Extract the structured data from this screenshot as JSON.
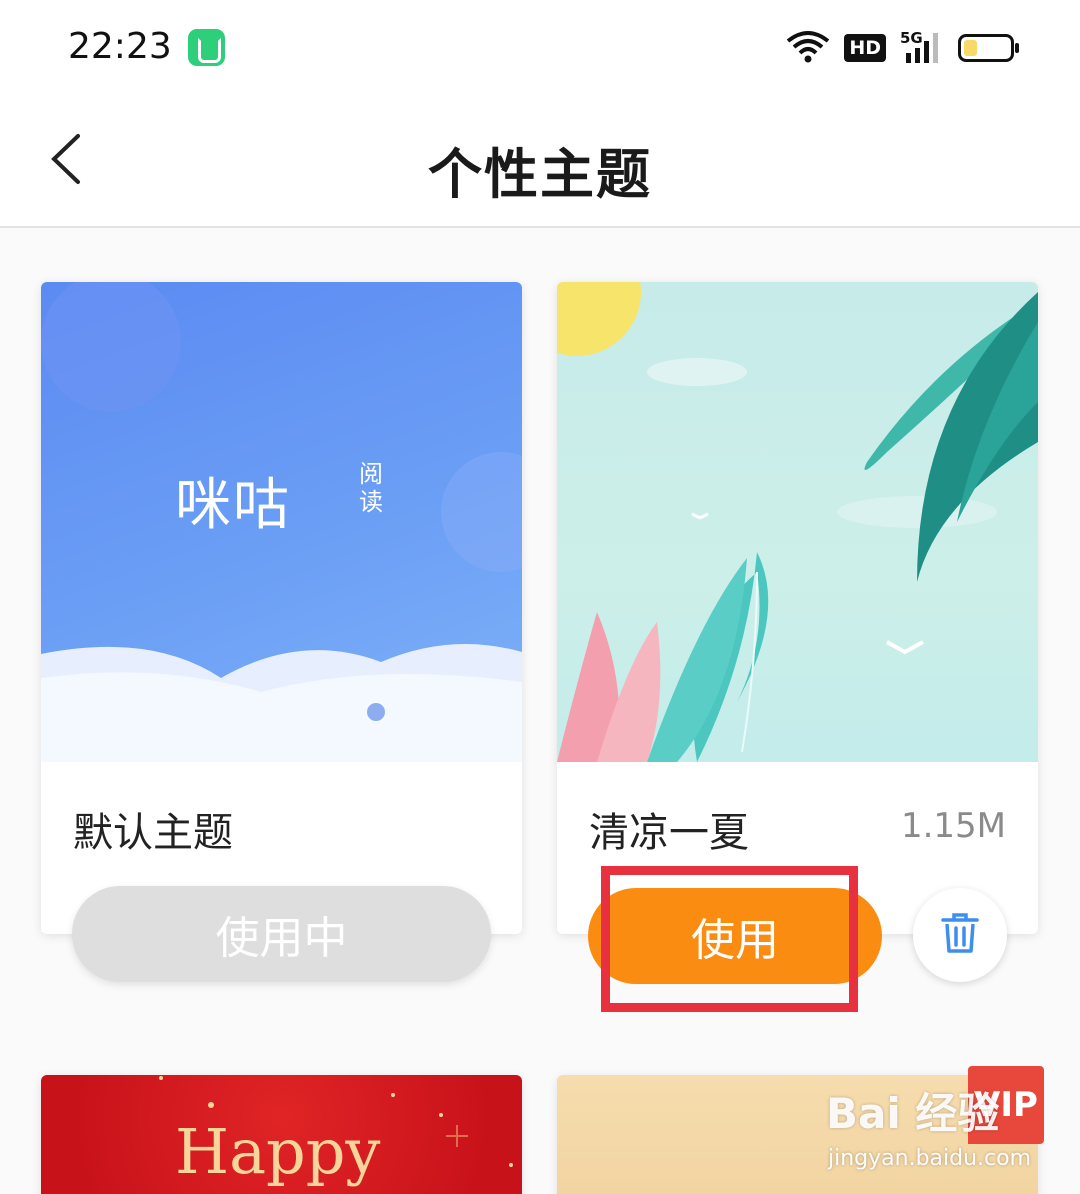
{
  "status_bar": {
    "time": "22:23",
    "network_badge": "HD",
    "network_type": "5G",
    "icons": [
      "app-icon",
      "wifi-icon",
      "hd-icon",
      "cellular-signal-icon",
      "battery-icon"
    ],
    "battery_level": 0.3
  },
  "header": {
    "title": "个性主题",
    "back_icon": "back-arrow-icon"
  },
  "themes": [
    {
      "name": "默认主题",
      "size": "",
      "cover_text": "咪咕",
      "cover_subtext": "阅读",
      "button": "使用中",
      "button_state": "in-use"
    },
    {
      "name": "清凉一夏",
      "size": "1.15M",
      "button": "使用",
      "button_state": "available",
      "delete_icon": "trash-icon",
      "highlighted": true
    },
    {
      "name": "",
      "cover_text": "Happy"
    },
    {
      "name": "",
      "badge": "VIP"
    }
  ],
  "watermark": {
    "text": "Bai 经验",
    "url": "jingyan.baidu.com"
  },
  "colors": {
    "accent_orange": "#fb8c12",
    "highlight_red": "#e8313e",
    "disabled_gray": "#dedede",
    "vip_red": "#e8483c",
    "app_badge_green": "#2ecf7a"
  }
}
